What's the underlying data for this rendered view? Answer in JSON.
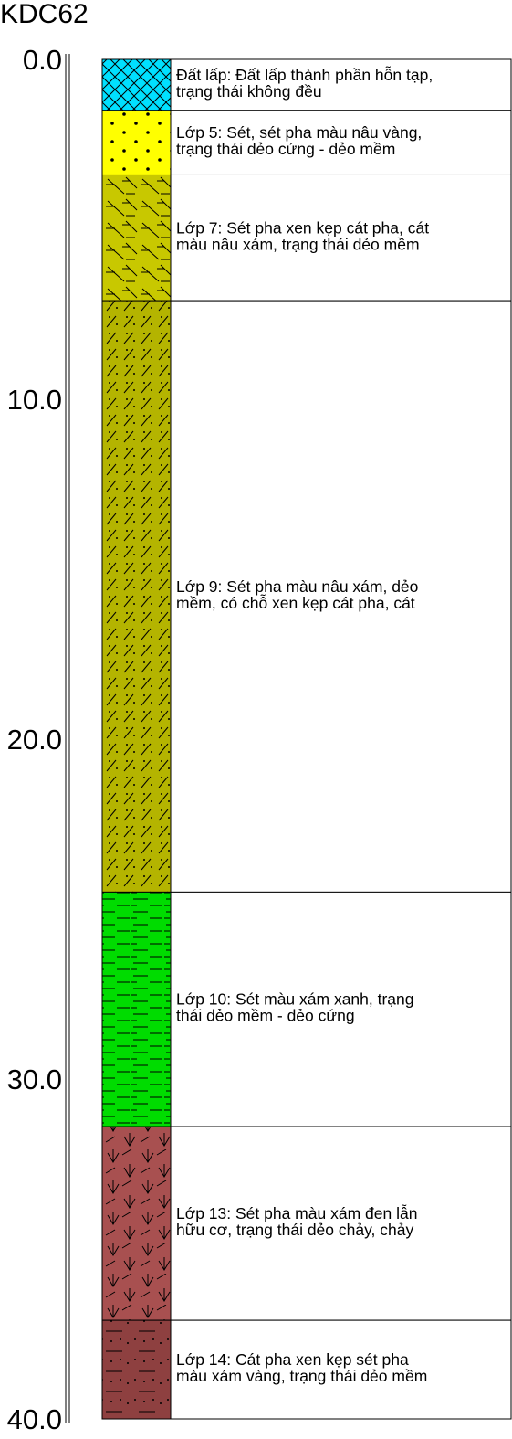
{
  "borehole": {
    "name": "KDC62"
  },
  "depth_ticks": [
    {
      "value": 0,
      "label": "0.0"
    },
    {
      "value": 10,
      "label": "10.0"
    },
    {
      "value": 20,
      "label": "20.0"
    },
    {
      "value": 30,
      "label": "30.0"
    },
    {
      "value": 40,
      "label": "40.0"
    }
  ],
  "depth_range": [
    0,
    40
  ],
  "layers": [
    {
      "id": "dat-lap",
      "top": 0.0,
      "bottom": 1.5,
      "color": "#00e0ff",
      "pattern": "crosshatch",
      "description": [
        "Đất lấp: Đất lấp thành phần hỗn tạp,",
        "trạng thái không đều"
      ]
    },
    {
      "id": "lop-5",
      "top": 1.5,
      "bottom": 3.4,
      "color": "#ffff00",
      "pattern": "dots",
      "description": [
        "Lớp 5: Sét, sét pha màu nâu vàng,",
        "trạng thái dẻo cứng - dẻo mềm"
      ]
    },
    {
      "id": "lop-7",
      "top": 3.4,
      "bottom": 7.1,
      "color": "#c8c800",
      "pattern": "slash-dash",
      "description": [
        "Lớp 7: Sét pha xen kẹp cát pha, cát",
        "màu nâu xám, trạng thái dẻo mềm"
      ]
    },
    {
      "id": "lop-9",
      "top": 7.1,
      "bottom": 24.5,
      "color": "#b4b400",
      "pattern": "slash-dots",
      "description": [
        "Lớp 9: Sét pha màu nâu xám, dẻo",
        "mềm, có chỗ xen kẹp cát pha, cát"
      ]
    },
    {
      "id": "lop-10",
      "top": 24.5,
      "bottom": 31.4,
      "color": "#00dc00",
      "pattern": "dashes",
      "description": [
        "Lớp 10: Sét màu xám xanh, trạng",
        "thái dẻo mềm - dẻo cứng"
      ]
    },
    {
      "id": "lop-13",
      "top": 31.4,
      "bottom": 37.1,
      "color": "#a85050",
      "pattern": "vee",
      "description": [
        "Lớp 13: Sét pha màu xám đen lẫn",
        "hữu cơ, trạng thái dẻo chảy, chảy"
      ]
    },
    {
      "id": "lop-14",
      "top": 37.1,
      "bottom": 40.0,
      "color": "#8e4040",
      "pattern": "dash-dots",
      "description": [
        "Lớp 14: Cát pha xen kẹp sét pha",
        "màu xám vàng, trạng thái dẻo mềm"
      ]
    }
  ]
}
